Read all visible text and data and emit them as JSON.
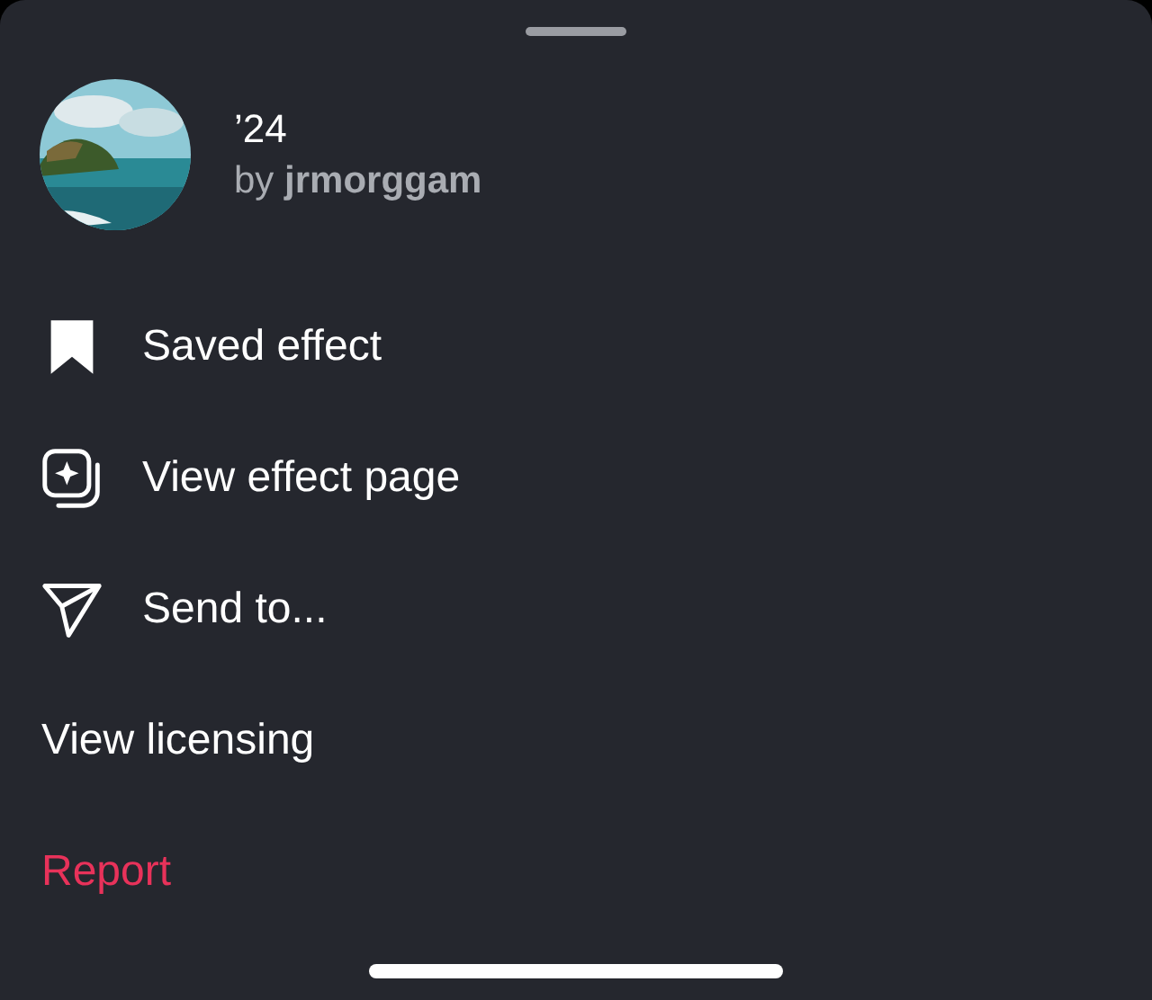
{
  "effect": {
    "title": "’24",
    "byline": "by **jrmorggam**"
  },
  "menu": [
    {
      "label": "Saved effect",
      "kind": "bookmark"
    },
    {
      "label": "View effect page",
      "kind": "effect"
    },
    {
      "label": "Send to...",
      "kind": "send"
    },
    {
      "label": "View licensing",
      "kind": "plain"
    },
    {
      "label": "Report",
      "kind": "danger"
    }
  ]
}
